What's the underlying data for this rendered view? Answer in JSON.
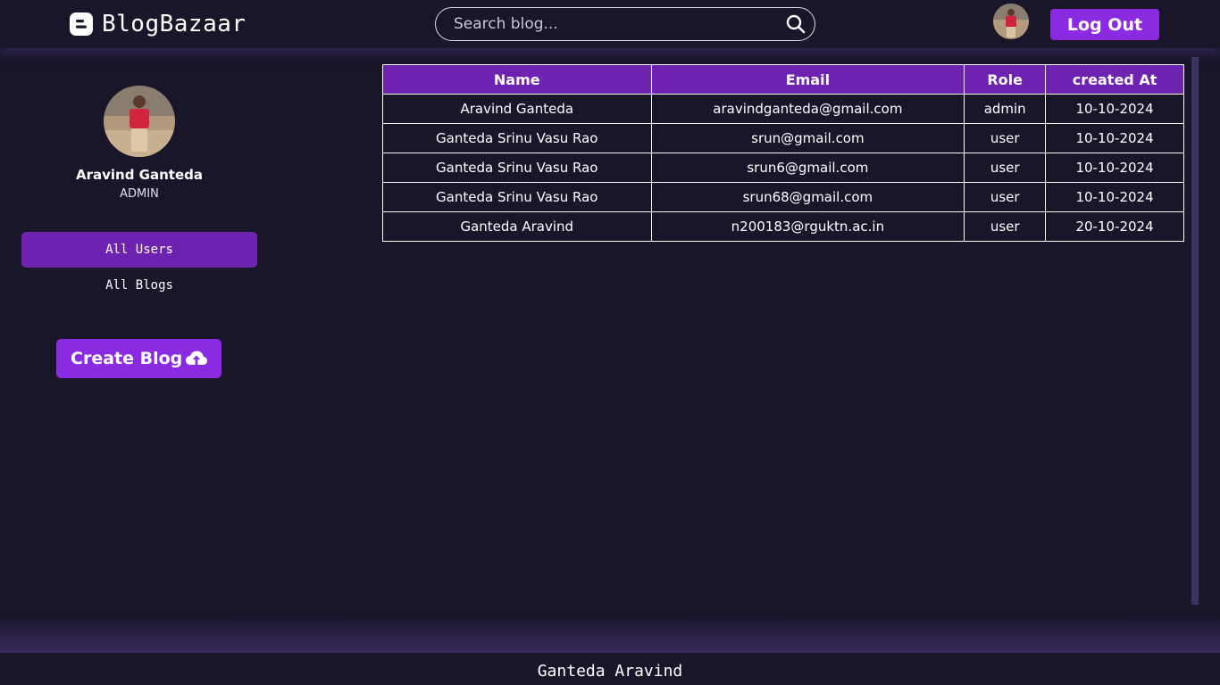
{
  "header": {
    "logo_text": "BlogBazaar",
    "search_placeholder": "Search blog...",
    "logout_label": "Log Out"
  },
  "sidebar": {
    "profile_name": "Aravind Ganteda",
    "profile_role": "ADMIN",
    "nav": [
      {
        "label": "All Users",
        "active": true
      },
      {
        "label": "All Blogs",
        "active": false
      }
    ],
    "create_label": "Create Blog"
  },
  "table": {
    "headers": [
      "Name",
      "Email",
      "Role",
      "created At"
    ],
    "rows": [
      [
        "Aravind Ganteda",
        "aravindganteda@gmail.com",
        "admin",
        "10-10-2024"
      ],
      [
        "Ganteda Srinu Vasu Rao",
        "srun@gmail.com",
        "user",
        "10-10-2024"
      ],
      [
        "Ganteda Srinu Vasu Rao",
        "srun6@gmail.com",
        "user",
        "10-10-2024"
      ],
      [
        "Ganteda Srinu Vasu Rao",
        "srun68@gmail.com",
        "user",
        "10-10-2024"
      ],
      [
        "Ganteda Aravind",
        "n200183@rguktn.ac.in",
        "user",
        "20-10-2024"
      ]
    ]
  },
  "footer": {
    "text": "Ganteda Aravind"
  },
  "icons": {
    "logo": "blogger-icon",
    "search": "search-icon",
    "create": "cloud-upload-icon"
  },
  "colors": {
    "background": "#19162a",
    "accent": "#8a2be2",
    "header_purple": "#6d22b0"
  }
}
